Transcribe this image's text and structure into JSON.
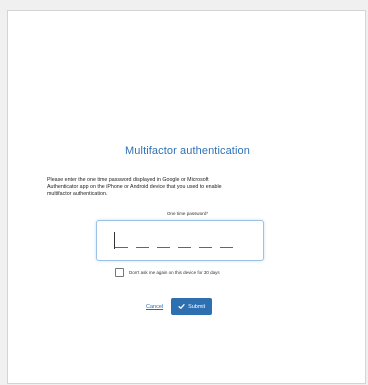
{
  "header": {
    "title": "Multifactor authentication"
  },
  "instructions": {
    "line1": "Please enter the one time password displayed in Google or Microsoft",
    "line2": "Authenticator app on the iPhone or Android device that you used to enable",
    "line3": "multifactor authentication."
  },
  "otp": {
    "label": "One time password",
    "required_mark": "*",
    "slot_count": 6,
    "value": ""
  },
  "remember": {
    "label": "Don't ask me again on this device for 30 days",
    "checked": false
  },
  "actions": {
    "cancel_label": "Cancel",
    "submit_label": "Submit",
    "submit_icon": "checkmark-icon"
  },
  "colors": {
    "accent": "#2d6fb0",
    "title": "#2f72b6",
    "required": "#d0021b"
  }
}
